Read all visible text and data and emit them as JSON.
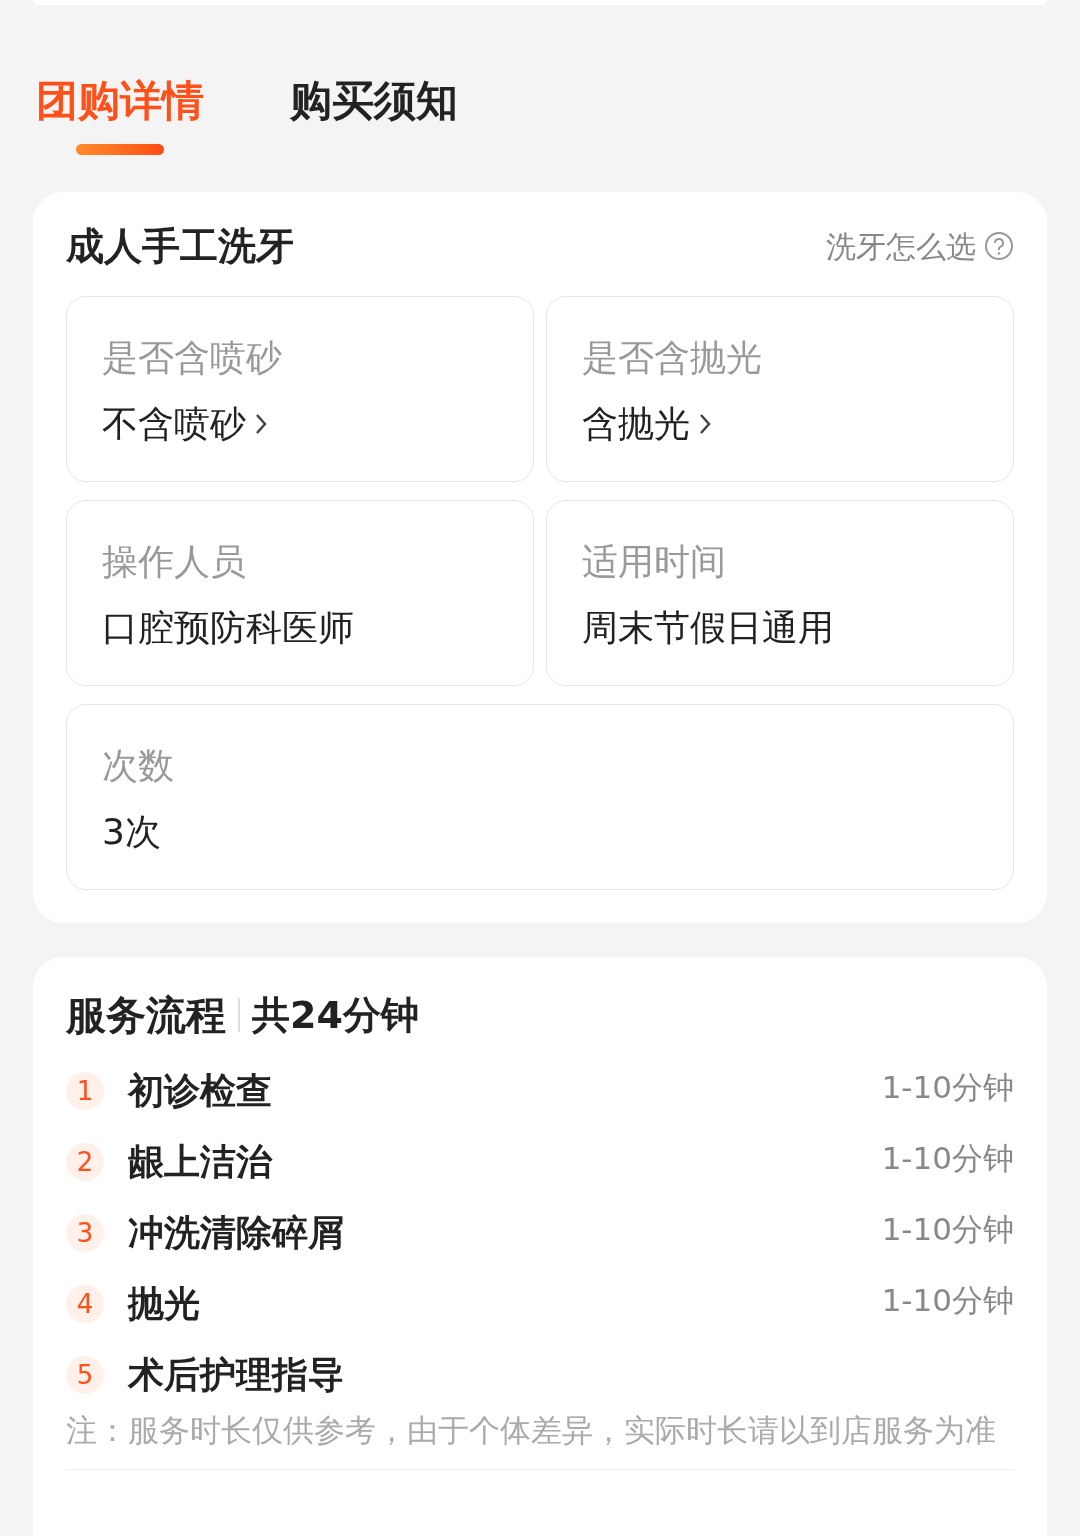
{
  "tabs": [
    {
      "label": "团购详情",
      "selected": true
    },
    {
      "label": "购买须知",
      "selected": false
    }
  ],
  "spec_card": {
    "title": "成人手工洗牙",
    "help_link": "洗牙怎么选",
    "options": [
      {
        "label": "是否含喷砂",
        "value": "不含喷砂",
        "chevron": true,
        "wide": false
      },
      {
        "label": "是否含抛光",
        "value": "含抛光",
        "chevron": true,
        "wide": false
      },
      {
        "label": "操作人员",
        "value": "口腔预防科医师",
        "chevron": false,
        "wide": false
      },
      {
        "label": "适用时间",
        "value": "周末节假日通用",
        "chevron": false,
        "wide": false
      },
      {
        "label": "次数",
        "value": "3次",
        "chevron": false,
        "wide": true
      }
    ]
  },
  "process_card": {
    "title": "服务流程",
    "total": "共24分钟",
    "steps": [
      {
        "number": "1",
        "name": "初诊检查",
        "duration": "1-10分钟"
      },
      {
        "number": "2",
        "name": "龈上洁治",
        "duration": "1-10分钟"
      },
      {
        "number": "3",
        "name": "冲洗清除碎屑",
        "duration": "1-10分钟"
      },
      {
        "number": "4",
        "name": "抛光",
        "duration": "1-10分钟"
      },
      {
        "number": "5",
        "name": "术后护理指导"
      }
    ],
    "note": "注：服务时长仅供参考，由于个体差异，实际时长请以到店服务为准"
  }
}
